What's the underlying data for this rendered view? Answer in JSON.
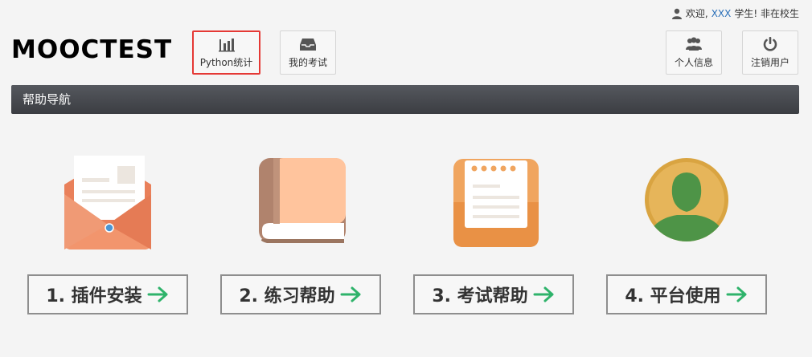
{
  "user": {
    "prefix": "欢迎,",
    "name": "XXX",
    "suffix": "学生! 非在校生"
  },
  "logo": {
    "text": "MOOCTEST"
  },
  "nav": {
    "python_stats": "Python统计",
    "my_exams": "我的考试",
    "profile": "个人信息",
    "logout": "注销用户"
  },
  "helpbar": {
    "title": "帮助导航"
  },
  "cards": [
    {
      "label": "1. 插件安装",
      "icon": "envelope-icon"
    },
    {
      "label": "2. 练习帮助",
      "icon": "book-icon"
    },
    {
      "label": "3. 考试帮助",
      "icon": "notepad-icon"
    },
    {
      "label": "4. 平台使用",
      "icon": "user-avatar-icon"
    }
  ],
  "colors": {
    "accent_green": "#2fb36b",
    "active_border": "#e53935",
    "link_blue": "#2a6fb8"
  }
}
